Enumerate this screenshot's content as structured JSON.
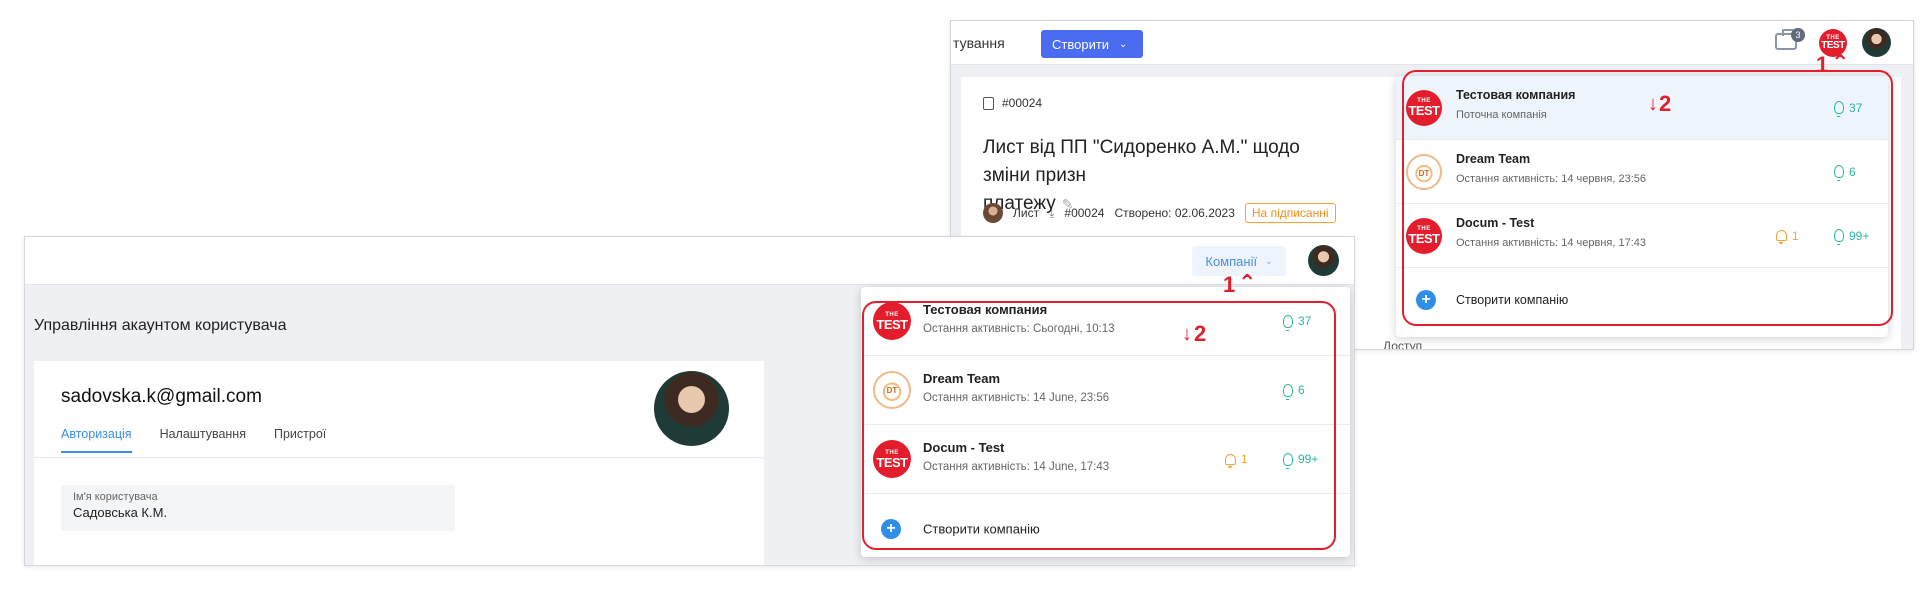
{
  "back": {
    "breadcrumb_fragment": "тування",
    "create_label": "Створити",
    "briefcase_badge": "3",
    "logo_the": "THE",
    "logo_test": "TEST",
    "doc_number": "#00024",
    "doc_title_line1": "Лист від ПП \"Сидоренко А.М.\" щодо зміни призн",
    "doc_title_line2": "платежу",
    "meta_type": "Лист",
    "meta_number": "#00024",
    "meta_created": "Створено: 02.06.2023",
    "meta_status": "На підписанні",
    "access_label": "Доступ",
    "companies": [
      {
        "name": "Тестовая компания",
        "subtitle": "Поточна компанія",
        "bulb_count": "37",
        "bell_count": ""
      },
      {
        "name": "Dream Team",
        "subtitle": "Остання активність: 14 червня, 23:56",
        "bulb_count": "6",
        "bell_count": ""
      },
      {
        "name": "Docum - Test",
        "subtitle": "Остання активність: 14 червня, 17:43",
        "bulb_count": "99+",
        "bell_count": "1"
      }
    ],
    "create_company_label": "Створити компанію"
  },
  "front": {
    "companies_button_label": "Компанії",
    "page_title": "Управління акаунтом користувача",
    "account_email": "sadovska.k@gmail.com",
    "tabs": [
      "Авторизація",
      "Налаштування",
      "Пристрої"
    ],
    "username_label": "Ім'я користувача",
    "username_value": "Садовська К.М.",
    "companies": [
      {
        "name": "Тестовая компания",
        "subtitle": "Остання активність: Сьогодні, 10:13",
        "bulb_count": "37",
        "bell_count": ""
      },
      {
        "name": "Dream Team",
        "subtitle": "Остання активність: 14 June, 23:56",
        "bulb_count": "6",
        "bell_count": ""
      },
      {
        "name": "Docum - Test",
        "subtitle": "Остання активність: 14 June, 17:43",
        "bulb_count": "99+",
        "bell_count": "1"
      }
    ],
    "create_company_label": "Створити компанію"
  },
  "annotations": {
    "step1": "1",
    "step2": "2"
  },
  "colors": {
    "accent_blue": "#4a6cf0",
    "link_blue": "#3a8ee6",
    "annotation_red": "#e0202e",
    "bulb_teal": "#2bb5a0",
    "bell_orange": "#f2a33a",
    "logo_red": "#e31d2b"
  }
}
